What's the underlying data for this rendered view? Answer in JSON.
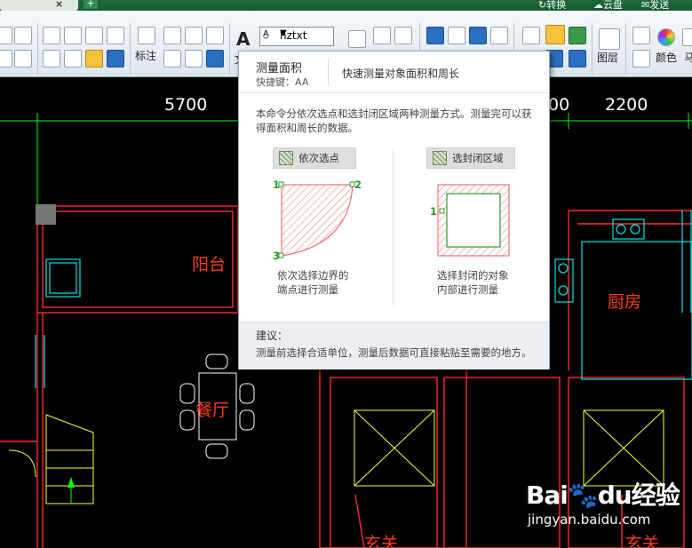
{
  "tabbar": {
    "close_glyph": "×",
    "new_glyph": "+",
    "top_right": [
      "转换",
      "云盘",
      "发送"
    ]
  },
  "ribbon": {
    "annotate_label": "标注",
    "text_style_value": "hztxt",
    "text_A": "A",
    "text_tool_partial": "文",
    "layer_label": "图层",
    "color_label": "颜色",
    "extra_label": "马"
  },
  "drawing": {
    "dimensions": [
      "5700",
      "00",
      "2200"
    ],
    "rooms": {
      "balcony": "阳台",
      "dining": "餐厅",
      "kitchen": "厨房",
      "entry_left": "玄关",
      "entry_right": "玄关"
    },
    "colors": {
      "wall": "#ff2a2a",
      "fixture": "#00e5e5",
      "door": "#ffff30",
      "furniture": "#ffffff",
      "dim": "#00ff00"
    }
  },
  "tooltip": {
    "title": "测量面积",
    "shortcut": "快捷键：AA",
    "summary": "快速测量对象面积和周长",
    "description": "本命令分依次选点和选封闭区域两种测量方式。测量完可以获得面积和周长的数据。",
    "mode_points": {
      "label": "依次选点",
      "caption_1": "依次选择边界的",
      "caption_2": "端点进行测量",
      "point_labels": [
        "1",
        "2",
        "3"
      ]
    },
    "mode_region": {
      "label": "选封闭区域",
      "caption_1": "选择封闭的对象",
      "caption_2": "内部进行测量",
      "point_label": "1"
    },
    "suggest_heading": "建议：",
    "suggest_text": "测量前选择合适单位，测量后数据可直接粘贴至需要的地方。"
  },
  "watermark": {
    "brand_a": "Bai",
    "brand_b": "du",
    "brand_c": "经验",
    "url": "jingyan.baidu.com"
  }
}
